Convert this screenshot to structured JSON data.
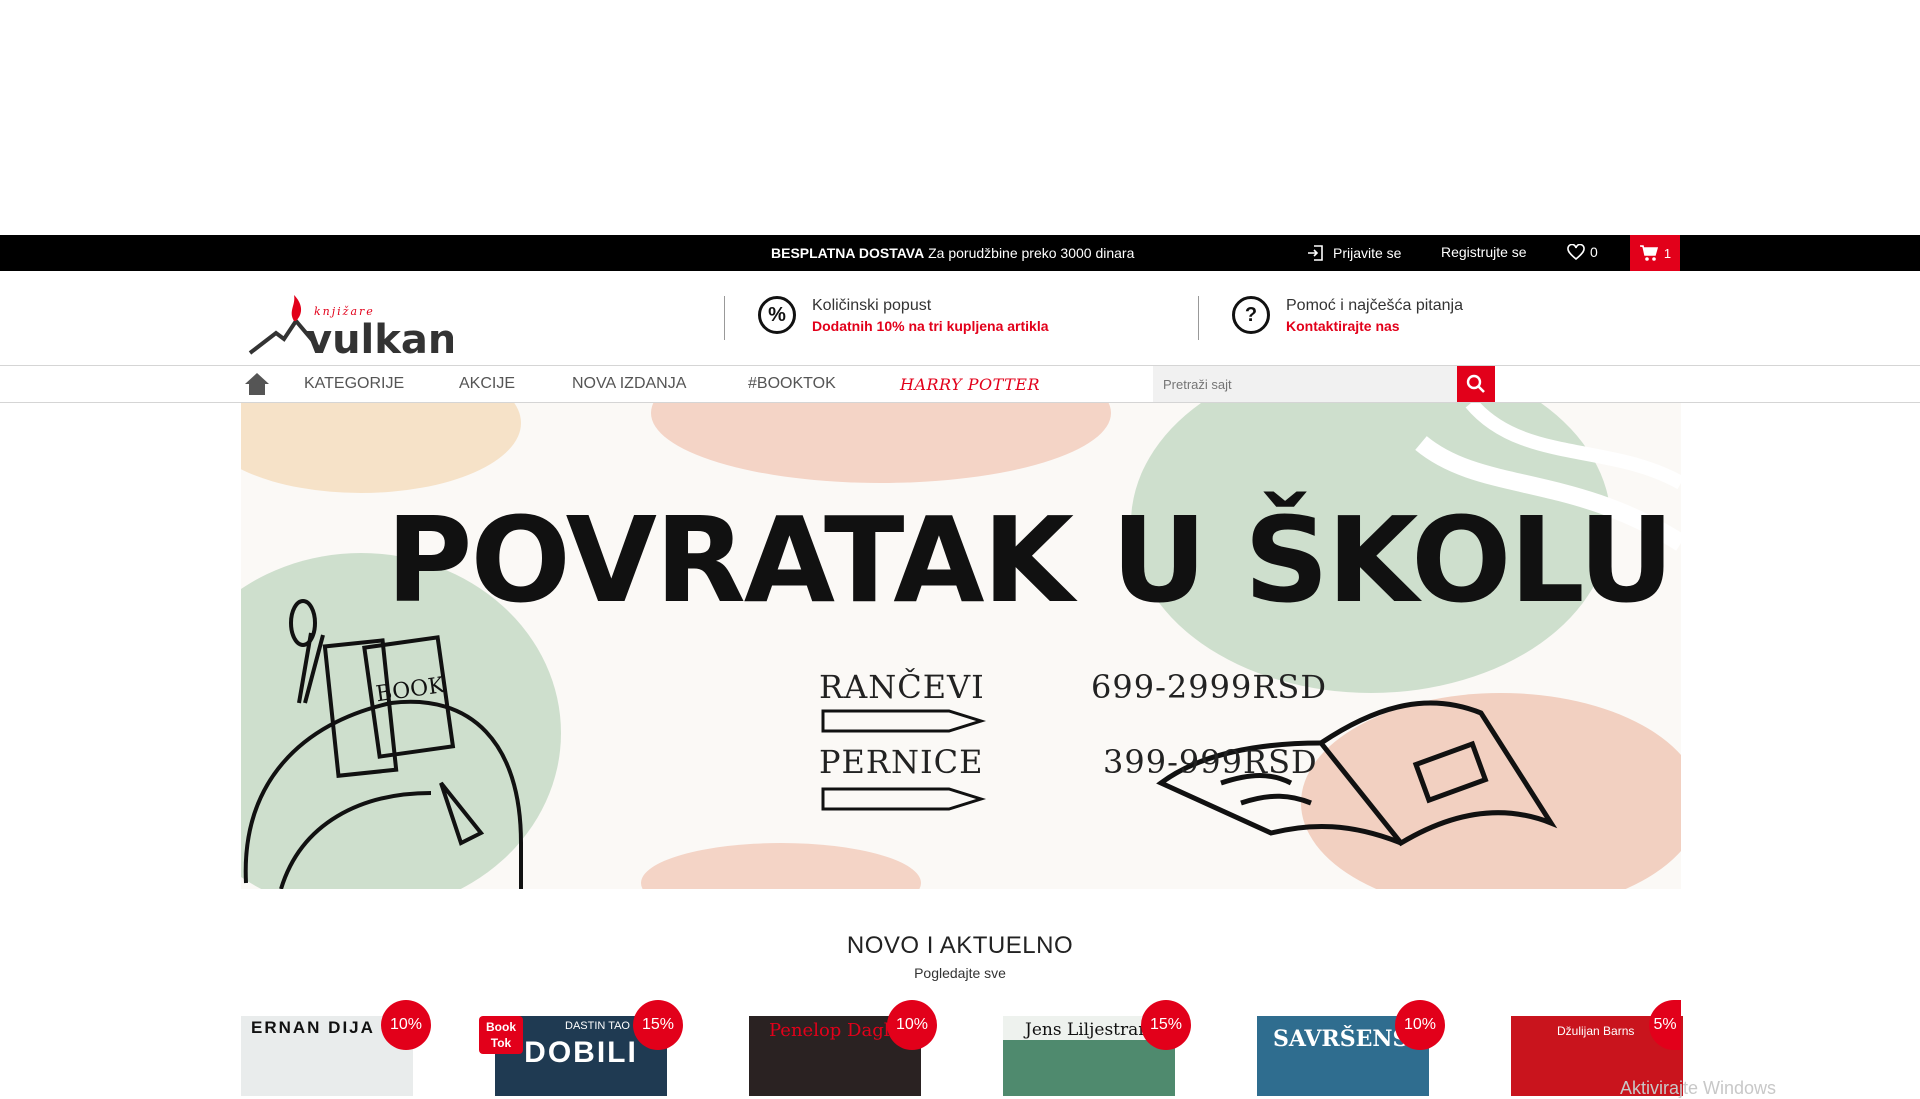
{
  "topbar": {
    "promo_bold": "BESPLATNA DOSTAVA",
    "promo_text": "Za porudžbine preko 3000 dinara",
    "login": "Prijavite se",
    "register": "Registrujte se",
    "wishlist_count": "0",
    "cart_count": "1"
  },
  "header": {
    "logo_small": "knjižare",
    "logo_text": "vulkan",
    "features": [
      {
        "title": "Količinski popust",
        "subtitle": "Dodatnih 10% na tri kupljena artikla",
        "icon": "percent-icon"
      },
      {
        "title": "Pomoć i najčešća pitanja",
        "subtitle": "Kontaktirajte nas",
        "icon": "question-icon"
      }
    ]
  },
  "nav": {
    "items": [
      "KATEGORIJE",
      "AKCIJE",
      "NOVA IZDANJA",
      "#BOOKTOK"
    ],
    "special": "HARRY POTTER",
    "search_placeholder": "Pretraži sajt"
  },
  "banner": {
    "title": "POVRATAK U ŠKOLU",
    "rows": [
      {
        "label": "RANČEVI",
        "price": "699-2999RSD"
      },
      {
        "label": "PERNICE",
        "price": "399-999RSD"
      }
    ],
    "book_label": "BOOK"
  },
  "section": {
    "title": "NOVO I AKTUELNO",
    "link": "Pogledajte sve"
  },
  "products": [
    {
      "cover_text": "ERNAN DIJA",
      "discount": "10%",
      "bg": "#e9ecec",
      "fg": "#111"
    },
    {
      "cover_text": "DOBILI",
      "author": "DASTIN TAO",
      "discount": "15%",
      "booktok": "Book Tok",
      "bg": "#1f3a52",
      "fg": "#fff"
    },
    {
      "cover_text": "Penelop Dagla",
      "discount": "10%",
      "bg": "#2a2222",
      "fg": "#e2001a"
    },
    {
      "cover_text": "Jens Liljestran",
      "discount": "15%",
      "bg": "#4f8a6e",
      "fg": "#111"
    },
    {
      "cover_text": "SAVRŠENSTVO",
      "discount": "10%",
      "bg": "#2f6d8f",
      "fg": "#fff"
    },
    {
      "cover_text": "Džulijan Barns",
      "discount": "5%",
      "bg": "#c9141d",
      "fg": "#fff"
    }
  ],
  "watermark": "Aktivirajte Windows",
  "colors": {
    "accent": "#e2001a",
    "topbar": "#000000"
  }
}
